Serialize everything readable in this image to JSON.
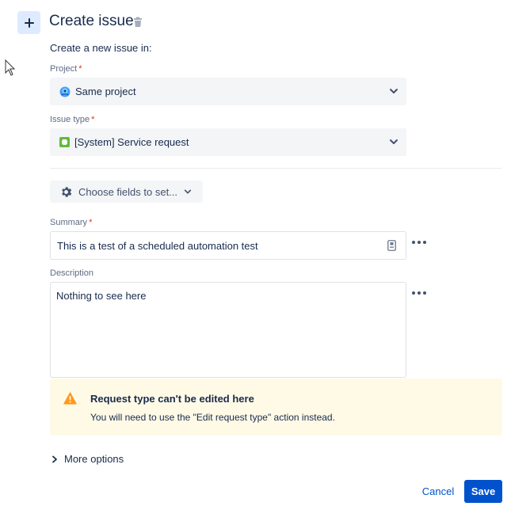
{
  "header": {
    "title": "Create issue"
  },
  "form": {
    "subtitle": "Create a new issue in:",
    "required_marker": "*",
    "project": {
      "label": "Project",
      "value": "Same project"
    },
    "issue_type": {
      "label": "Issue type",
      "value": "[System] Service request"
    },
    "choose_fields": {
      "label": "Choose fields to set..."
    },
    "summary": {
      "label": "Summary",
      "value": "This is a test of a scheduled automation test"
    },
    "description": {
      "label": "Description",
      "value": "Nothing to see here"
    },
    "warning": {
      "title": "Request type can't be edited here",
      "body": "You will need to use the \"Edit request type\" action instead."
    },
    "more_options": {
      "label": "More options"
    }
  },
  "footer": {
    "cancel_label": "Cancel",
    "save_label": "Save"
  },
  "colors": {
    "accent": "#0052cc",
    "warning_bg": "#fffae6",
    "warning_icon": "#ff991f",
    "required": "#de350b",
    "issue_type_icon": "#63ba3c"
  },
  "icons": {
    "header": "plus-icon",
    "trash": "trash-icon",
    "project": "project-avatar-icon",
    "issue_type": "service-request-icon",
    "chooser": "gear-icon",
    "summary_field": "field-reference-icon",
    "warning": "warning-icon",
    "expand": "chevron-right-icon",
    "dropdown": "chevron-down-icon",
    "more": "more-icon"
  }
}
